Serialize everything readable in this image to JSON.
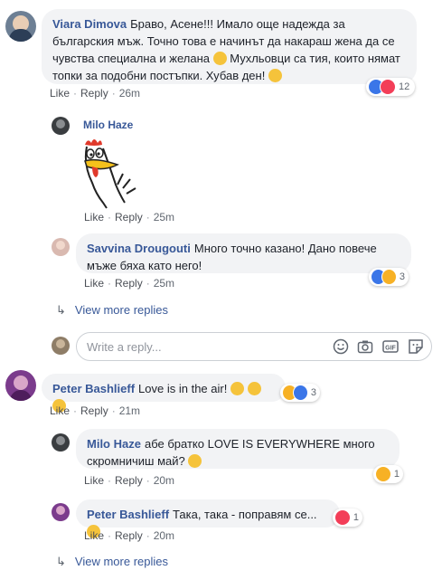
{
  "comments": [
    {
      "author": "Viara Dimova",
      "text": "Браво, Асене!!! Имало още надежда за българския мъж. Точно това е начинът да накараш жена да се чувства специална и желана",
      "text2": " Мухльовци са тия, които нямат топки за подобни постъпки. Хубав ден!",
      "like": "Like",
      "reply": "Reply",
      "time": "26m",
      "reactions": "12"
    },
    {
      "author": "Milo Haze",
      "like": "Like",
      "reply": "Reply",
      "time": "25m"
    },
    {
      "author": "Savvina Drougouti",
      "text": "Много точно казано! Дано повече мъже бяха като него!",
      "like": "Like",
      "reply": "Reply",
      "time": "25m",
      "reactions": "3"
    },
    {
      "author": "Peter Bashlieff",
      "text": "Love is in the air!",
      "like": "Like",
      "reply": "Reply",
      "time": "21m",
      "reactions": "3"
    },
    {
      "author": "Milo Haze",
      "text": "абе братко LOVE IS EVERYWHERE много скромничиш май?",
      "like": "Like",
      "reply": "Reply",
      "time": "20m",
      "reactions": "1"
    },
    {
      "author": "Peter Bashlieff",
      "text": "Така, така - поправям се...",
      "like": "Like",
      "reply": "Reply",
      "time": "20m",
      "reactions": "1"
    }
  ],
  "view_more_1": "View more replies",
  "view_more_2": "View more replies",
  "composer": {
    "placeholder": "Write a reply..."
  },
  "icons": [
    "emoji-icon",
    "camera-icon",
    "gif-icon",
    "sticker-icon"
  ],
  "colors": {
    "link": "#385898",
    "bubble": "#f2f3f5",
    "like": "#3b76e8",
    "love": "#f33e58",
    "haha": "#f7b125"
  }
}
